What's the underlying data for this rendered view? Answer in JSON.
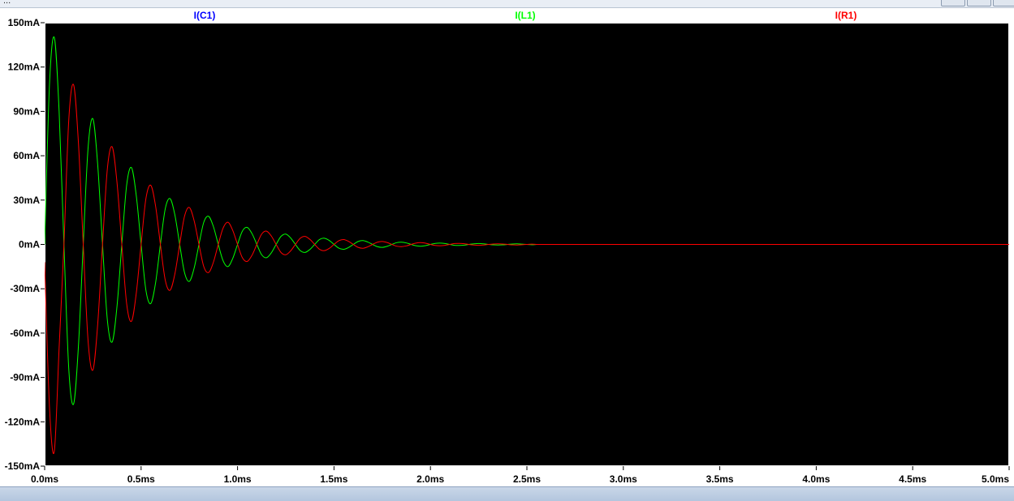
{
  "window": {
    "title": "..."
  },
  "chart_data": {
    "type": "line",
    "x_unit": "ms",
    "y_unit": "mA",
    "xlim": [
      0,
      5.0
    ],
    "ylim": [
      -150,
      150
    ],
    "x_ticks": [
      "0.0ms",
      "0.5ms",
      "1.0ms",
      "1.5ms",
      "2.0ms",
      "2.5ms",
      "3.0ms",
      "3.5ms",
      "4.0ms",
      "4.5ms",
      "5.0ms"
    ],
    "y_ticks": [
      "150mA",
      "120mA",
      "90mA",
      "60mA",
      "30mA",
      "0mA",
      "-30mA",
      "-60mA",
      "-90mA",
      "-120mA",
      "-150mA"
    ],
    "background": "#000000",
    "axis_color": "#ffffff",
    "grid": false,
    "legend_position": "top",
    "series": [
      {
        "name": "I(C1)",
        "color": "#0000ff",
        "x": [],
        "y": []
      },
      {
        "name": "I(L1)",
        "color": "#00ff00",
        "x": [
          0.0,
          0.025,
          0.05,
          0.075,
          0.1,
          0.125,
          0.15,
          0.175,
          0.2,
          0.225,
          0.25,
          0.275,
          0.3,
          0.325,
          0.35,
          0.375,
          0.4,
          0.425,
          0.45,
          0.475,
          0.5,
          0.525,
          0.55,
          0.575,
          0.6,
          0.625,
          0.65,
          0.675,
          0.7,
          0.725,
          0.75,
          0.775,
          0.8,
          0.825,
          0.85,
          0.875,
          0.9,
          0.925,
          0.95,
          0.975,
          1.0,
          1.025,
          1.05,
          1.075,
          1.1,
          1.125,
          1.15,
          1.175,
          1.2,
          1.225,
          1.25,
          1.275,
          1.3,
          1.325,
          1.35,
          1.375,
          1.4,
          1.425,
          1.45,
          1.475,
          1.5,
          1.525,
          1.55,
          1.575,
          1.6,
          1.625,
          1.65,
          1.675,
          1.7,
          1.725,
          1.75,
          1.775,
          1.8,
          1.825,
          1.85,
          1.875,
          1.9,
          1.925,
          1.95,
          1.975,
          2.0,
          2.025,
          2.05,
          2.075,
          2.1,
          2.125,
          2.15,
          2.175,
          2.2,
          2.225,
          2.25,
          2.275,
          2.3,
          2.325,
          2.35,
          2.375,
          2.4,
          2.425,
          2.45,
          2.475,
          2.5,
          2.525,
          2.55
        ],
        "y": [
          0,
          108,
          140,
          90,
          0,
          -84,
          -108,
          -69,
          0,
          65,
          85,
          54,
          0,
          -51,
          -66,
          -42,
          0,
          40,
          52,
          33,
          0,
          -31,
          -40,
          -26,
          0,
          24,
          31,
          20,
          0,
          -19,
          -25,
          -16,
          0,
          15,
          19,
          12,
          0,
          -11,
          -15,
          -9.5,
          0,
          9,
          11.5,
          7.3,
          0,
          -7,
          -9,
          -5.7,
          0,
          5.4,
          7,
          4.4,
          0,
          -4.2,
          -5.4,
          -3.4,
          0,
          3.3,
          4.2,
          2.7,
          0,
          -2.5,
          -3.3,
          -2.1,
          0,
          2.0,
          2.6,
          1.6,
          0,
          -1.5,
          -2.0,
          -1.3,
          0,
          1.2,
          1.5,
          1.0,
          0,
          -0.9,
          -1.2,
          -0.8,
          0,
          0.7,
          0.9,
          0.6,
          0,
          -0.6,
          -0.7,
          -0.5,
          0,
          0.4,
          0.6,
          0.4,
          0,
          -0.3,
          -0.4,
          -0.3,
          0,
          0.3,
          0.4,
          0.2,
          0,
          -0.2,
          0
        ]
      },
      {
        "name": "I(R1)",
        "color": "#ff0000",
        "x": [
          0.0,
          0.025,
          0.05,
          0.075,
          0.1,
          0.125,
          0.15,
          0.175,
          0.2,
          0.225,
          0.25,
          0.275,
          0.3,
          0.325,
          0.35,
          0.375,
          0.4,
          0.425,
          0.45,
          0.475,
          0.5,
          0.525,
          0.55,
          0.575,
          0.6,
          0.625,
          0.65,
          0.675,
          0.7,
          0.725,
          0.75,
          0.775,
          0.8,
          0.825,
          0.85,
          0.875,
          0.9,
          0.925,
          0.95,
          0.975,
          1.0,
          1.025,
          1.05,
          1.075,
          1.1,
          1.125,
          1.15,
          1.175,
          1.2,
          1.225,
          1.25,
          1.275,
          1.3,
          1.325,
          1.35,
          1.375,
          1.4,
          1.425,
          1.45,
          1.475,
          1.5,
          1.525,
          1.55,
          1.575,
          1.6,
          1.625,
          1.65,
          1.675,
          1.7,
          1.725,
          1.75,
          1.775,
          1.8,
          1.825,
          1.85,
          1.875,
          1.9,
          1.925,
          1.95,
          1.975,
          2.0,
          2.025,
          2.05,
          2.075,
          2.1,
          2.125,
          2.15,
          2.175,
          2.2,
          2.225,
          2.25,
          2.275,
          2.3,
          2.325,
          2.35,
          2.375,
          2.4,
          2.425,
          2.45,
          2.475,
          2.5,
          2.525,
          2.55,
          2.6,
          3.0,
          3.5,
          4.0,
          4.5,
          5.0
        ],
        "y": [
          -12,
          -110,
          -140,
          -70,
          0,
          84,
          108,
          69,
          0,
          -65,
          -85,
          -54,
          0,
          51,
          66,
          42,
          0,
          -40,
          -52,
          -33,
          0,
          31,
          40,
          26,
          0,
          -24,
          -31,
          -20,
          0,
          19,
          25,
          16,
          0,
          -15,
          -19,
          -12,
          0,
          11,
          15,
          9.5,
          0,
          -9,
          -11.5,
          -7.3,
          0,
          7,
          9,
          5.7,
          0,
          -5.4,
          -7,
          -4.4,
          0,
          4.2,
          5.4,
          3.4,
          0,
          -3.3,
          -4.2,
          -2.7,
          0,
          2.5,
          3.3,
          2.1,
          0,
          -2.0,
          -2.6,
          -1.6,
          0,
          1.5,
          2.0,
          1.3,
          0,
          -1.2,
          -1.5,
          -1.0,
          0,
          0.9,
          1.2,
          0.8,
          0,
          -0.7,
          -0.9,
          -0.6,
          0,
          0.6,
          0.7,
          0.5,
          0,
          -0.4,
          -0.6,
          -0.4,
          0,
          0.3,
          0.4,
          0.3,
          0,
          -0.3,
          -0.4,
          -0.2,
          0,
          0.2,
          0,
          0,
          0,
          0,
          0,
          0,
          0
        ]
      }
    ]
  }
}
